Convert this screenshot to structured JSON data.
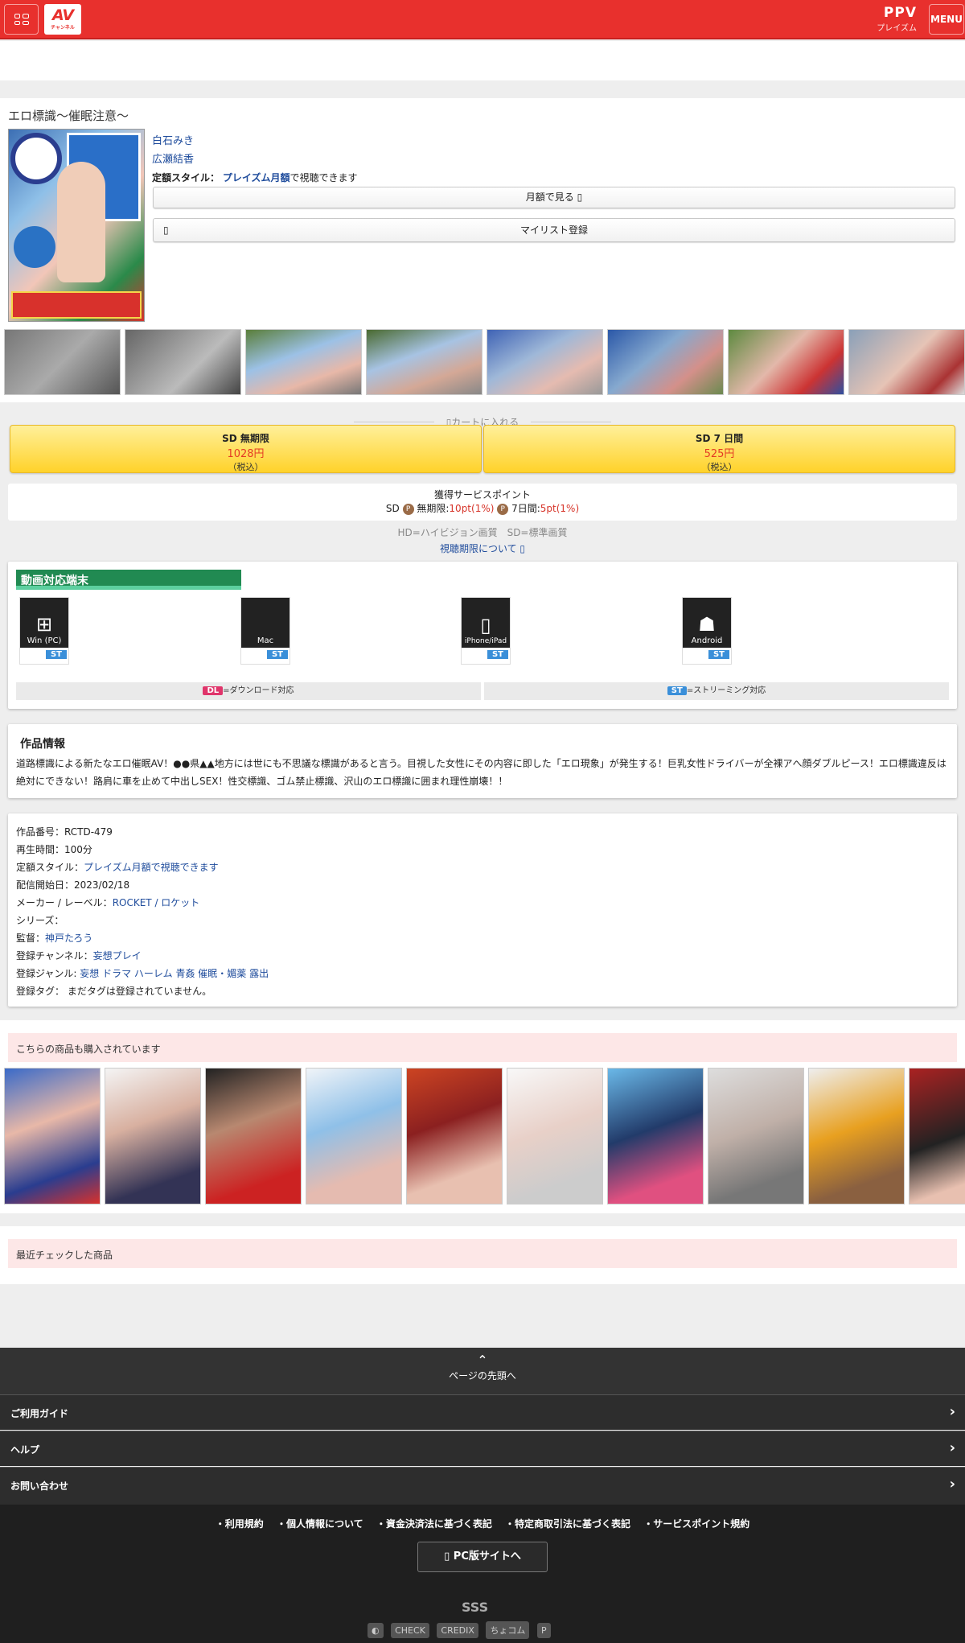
{
  "header": {
    "logo_text": "AV",
    "logo_sub": "チャンネル",
    "ppv_label": "PPV",
    "ppv_sub": "プレイズム",
    "menu_label": "MENU"
  },
  "product": {
    "title": "エロ標識〜催眠注意〜",
    "actresses": [
      "白石みき",
      "広瀬結香"
    ],
    "price_style_label": "定額スタイル：",
    "price_style_link": "プレイズム月額",
    "price_style_suffix": "で視聴できます",
    "monthly_button": "月額で見る ",
    "mylist_button": "マイリスト登録"
  },
  "cart": {
    "label": "カートに入れる",
    "options": [
      {
        "quality": "SD 無期限",
        "price": "1028円",
        "tax": "（税込）"
      },
      {
        "quality": "SD 7 日間",
        "price": "525円",
        "tax": "（税込）"
      }
    ]
  },
  "points": {
    "title": "獲得サービスポイント",
    "sd": "SD",
    "unlimited_label": "無期限:",
    "unlimited_value": "10pt(1%)",
    "week_label": "7日間:",
    "week_value": "5pt(1%)",
    "p_icon": "P"
  },
  "quality_note": "HD=ハイビジョン画質　SD=標準画質",
  "view_limit_link": "視聴期限について ",
  "devices": {
    "title": "動画対応端末",
    "items": [
      {
        "name": "Win (PC)",
        "icon": "windows-icon",
        "badge": "ST"
      },
      {
        "name": "Mac",
        "icon": "apple-icon",
        "badge": "ST"
      },
      {
        "name": "iPhone/iPad",
        "icon": "iphone-icon",
        "badge": "ST"
      },
      {
        "name": "Android",
        "icon": "android-icon",
        "badge": "ST"
      }
    ],
    "legend_dl_badge": "DL",
    "legend_dl": "=ダウンロード対応",
    "legend_st_badge": "ST",
    "legend_st": "=ストリーミング対応"
  },
  "info": {
    "heading": "作品情報",
    "description": "道路標識による新たなエロ催眠AV！●●県▲▲地方には世にも不思議な標識があると言う。目視した女性にその内容に即した「エロ現象」が発生する！巨乳女性ドライバーが全裸アへ顔ダブルピース！エロ標識違反は絶対にできない！路肩に車を止めて中出しSEX！性交標識、ゴム禁止標識、沢山のエロ標識に囲まれ理性崩壊！！"
  },
  "spec": {
    "code": "作品番号：RCTD-479",
    "duration": "再生時間：100分",
    "style_label": "定額スタイル：",
    "style_link": "プレイズム月額で視聴できます",
    "release": "配信開始日：2023/02/18",
    "maker_label": "メーカー / レーベル：",
    "maker_link": "ROCKET / ロケット",
    "series": "シリーズ：",
    "director_label": "監督：",
    "director_link": "神戸たろう",
    "channel_label": "登録チャンネル：",
    "channel_link": "妄想プレイ",
    "genre_label": "登録ジャンル: ",
    "genre_links": "妄想 ドラマ ハーレム 青姦 催眠・媚薬 露出",
    "tags": "登録タグ： まだタグは登録されていません。"
  },
  "also_bought": "こちらの商品も購入されています",
  "recently_checked": "最近チェックした商品",
  "footer": {
    "page_top": "ページの先頭へ",
    "rows": [
      "ご利用ガイド",
      "ヘルプ",
      "お問い合わせ"
    ],
    "links": [
      "・利用規約",
      "・個人情報について",
      "・資金決済法に基づく表記",
      "・特定商取引法に基づく表記",
      "・サービスポイント規約"
    ],
    "pc_site": " PC版サイトへ",
    "sss": "SSS",
    "partner_logos": [
      "CHECK",
      "CREDIX",
      "ちょコム",
      "P"
    ]
  }
}
